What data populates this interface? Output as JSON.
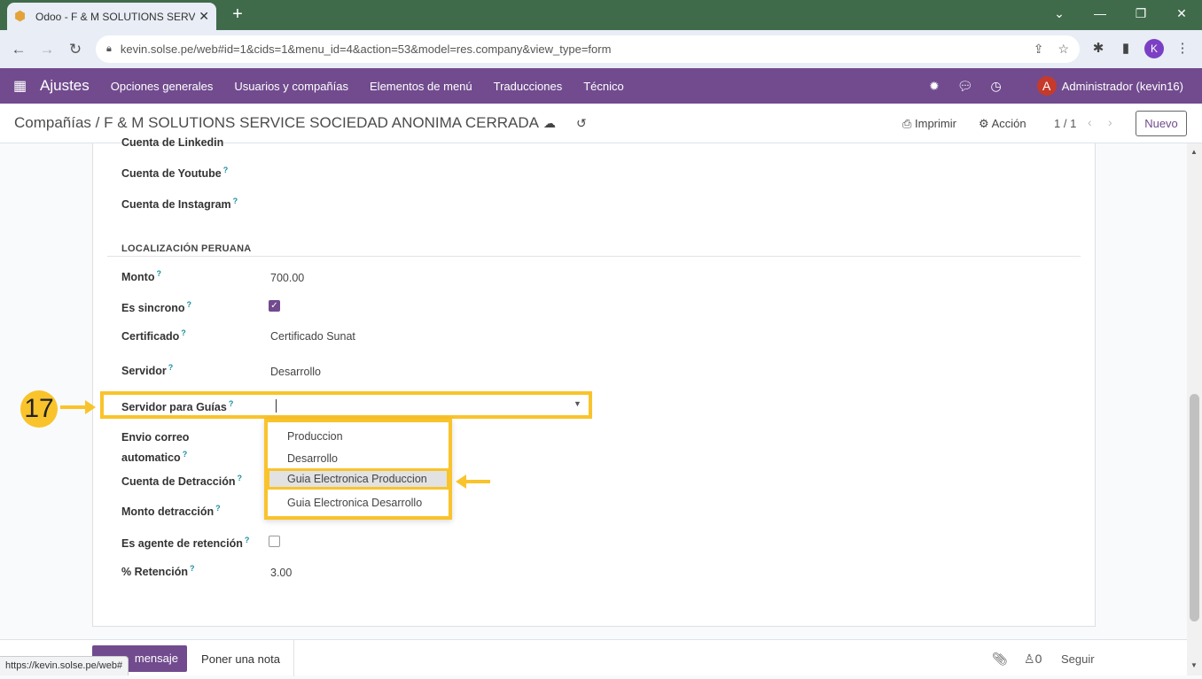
{
  "browser": {
    "tab_title": "Odoo - F & M SOLUTIONS SERV",
    "url": "kevin.solse.pe/web#id=1&cids=1&menu_id=4&action=53&model=res.company&view_type=form",
    "profile_initial": "K",
    "status_url": "https://kevin.solse.pe/web#"
  },
  "navbar": {
    "app_name": "Ajustes",
    "menu": [
      "Opciones generales",
      "Usuarios y compañías",
      "Elementos de menú",
      "Traducciones",
      "Técnico"
    ],
    "user_initial": "A",
    "user_name": "Administrador (kevin16)"
  },
  "control": {
    "breadcrumb": "Compañías / F & M SOLUTIONS SERVICE SOCIEDAD ANONIMA CERRADA",
    "print": "Imprimir",
    "action": "Acción",
    "pager": "1 / 1",
    "new": "Nuevo"
  },
  "form": {
    "cut_label": "Cuenta de Linkedin",
    "youtube": "Cuenta de Youtube",
    "instagram": "Cuenta de Instagram",
    "section": "LOCALIZACIÓN PERUANA",
    "monto_label": "Monto",
    "monto_value": "700.00",
    "sincrono_label": "Es sincrono",
    "sincrono_checked": true,
    "cert_label": "Certificado",
    "cert_value": "Certificado Sunat",
    "servidor_label": "Servidor",
    "servidor_value": "Desarrollo",
    "guias_label": "Servidor para Guías",
    "envio_label_1": "Envio correo",
    "envio_label_2": "automatico",
    "detraccion_label": "Cuenta de Detracción",
    "monto_det_label": "Monto detracción",
    "agente_label": "Es agente de retención",
    "agente_checked": false,
    "retencion_label": "% Retención",
    "retencion_value": "3.00",
    "help": "?"
  },
  "dropdown": {
    "options": [
      "Produccion",
      "Desarrollo",
      "Guia Electronica Produccion",
      "Guia Electronica Desarrollo"
    ],
    "highlighted": "Guia Electronica Produccion"
  },
  "annotation": {
    "step": "17",
    "accent": "#f9c32b"
  },
  "chatter": {
    "send": "mensaje",
    "note": "Poner una nota",
    "followers": "0",
    "follow": "Seguir"
  }
}
